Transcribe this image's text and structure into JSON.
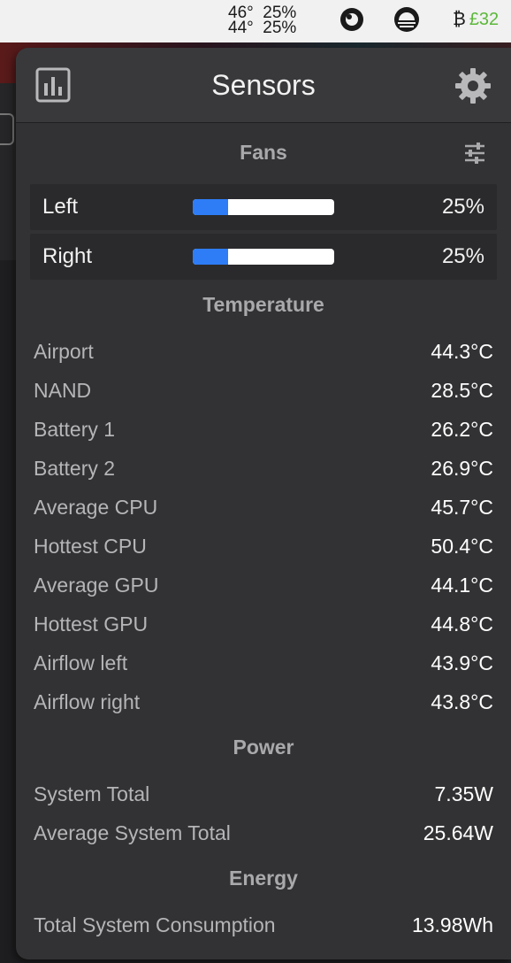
{
  "menubar": {
    "stats_line1": "46°  25%",
    "stats_line2": "44°  25%",
    "btc_symbol": "₿",
    "btc_price": "£32"
  },
  "header": {
    "title": "Sensors"
  },
  "fans": {
    "title": "Fans",
    "items": [
      {
        "label": "Left",
        "percent": "25%",
        "level": 25
      },
      {
        "label": "Right",
        "percent": "25%",
        "level": 25
      }
    ]
  },
  "temperature": {
    "title": "Temperature",
    "items": [
      {
        "label": "Airport",
        "value": "44.3°C"
      },
      {
        "label": "NAND",
        "value": "28.5°C"
      },
      {
        "label": "Battery 1",
        "value": "26.2°C"
      },
      {
        "label": "Battery 2",
        "value": "26.9°C"
      },
      {
        "label": "Average CPU",
        "value": "45.7°C"
      },
      {
        "label": "Hottest CPU",
        "value": "50.4°C"
      },
      {
        "label": "Average GPU",
        "value": "44.1°C"
      },
      {
        "label": "Hottest GPU",
        "value": "44.8°C"
      },
      {
        "label": "Airflow left",
        "value": "43.9°C"
      },
      {
        "label": "Airflow right",
        "value": "43.8°C"
      }
    ]
  },
  "power": {
    "title": "Power",
    "items": [
      {
        "label": "System Total",
        "value": "7.35W"
      },
      {
        "label": "Average System Total",
        "value": "25.64W"
      }
    ]
  },
  "energy": {
    "title": "Energy",
    "items": [
      {
        "label": "Total System Consumption",
        "value": "13.98Wh"
      }
    ]
  },
  "colors": {
    "fan_bar_fill": "#2e7cf6",
    "btc_price": "#5cb83a"
  },
  "icons": [
    "chart-icon",
    "gear-icon",
    "filter-sliders-icon",
    "stats-app-icon",
    "weather-icon",
    "bitcoin-icon"
  ]
}
